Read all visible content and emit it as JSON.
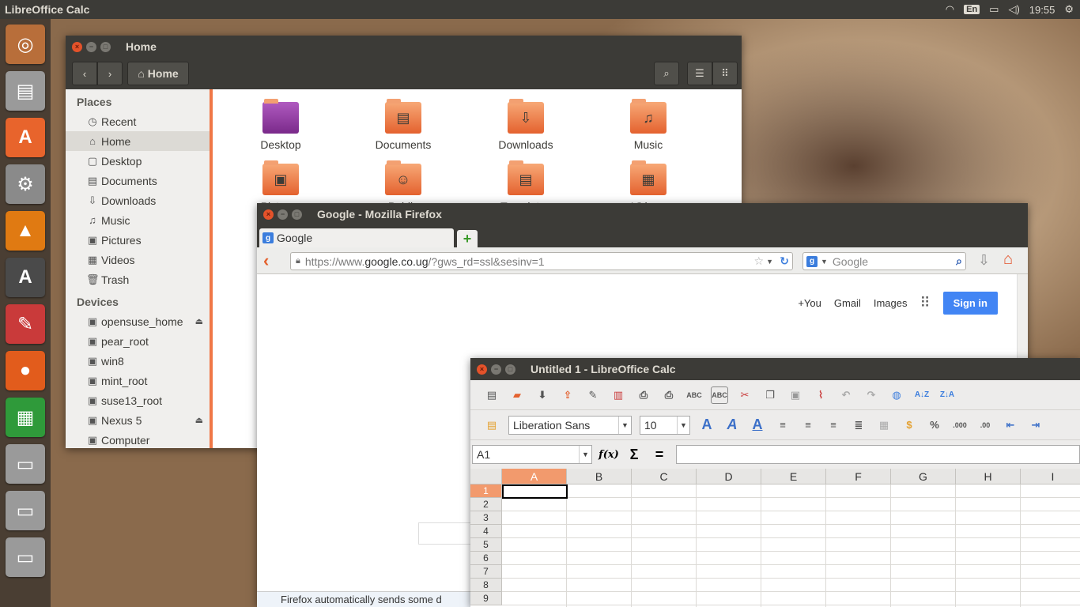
{
  "topbar": {
    "app_title": "LibreOffice Calc",
    "lang": "En",
    "time": "19:55"
  },
  "launcher": [
    {
      "name": "ubuntu-icon",
      "glyph": "◎",
      "color": "#b86e3a"
    },
    {
      "name": "files-icon",
      "glyph": "▤",
      "color": "#9a9a9a"
    },
    {
      "name": "software-center-icon",
      "glyph": "A",
      "color": "#e8642c"
    },
    {
      "name": "system-settings-icon",
      "glyph": "⚙",
      "color": "#8a8a8a"
    },
    {
      "name": "vlc-icon",
      "glyph": "▲",
      "color": "#e07a12"
    },
    {
      "name": "update-manager-icon",
      "glyph": "A",
      "color": "#4a4a4a"
    },
    {
      "name": "document-viewer-icon",
      "glyph": "✎",
      "color": "#c93a3a"
    },
    {
      "name": "firefox-icon",
      "glyph": "●",
      "color": "#e25c1c"
    },
    {
      "name": "libreoffice-calc-icon",
      "glyph": "▦",
      "color": "#2f9a3a"
    },
    {
      "name": "drive-icon",
      "glyph": "▭",
      "color": "#9a9a9a"
    },
    {
      "name": "drive-icon",
      "glyph": "▭",
      "color": "#9a9a9a"
    },
    {
      "name": "drive-icon",
      "glyph": "▭",
      "color": "#9a9a9a"
    }
  ],
  "nautilus": {
    "title": "Home",
    "location": "Home",
    "places_header": "Places",
    "places": [
      "Recent",
      "Home",
      "Desktop",
      "Documents",
      "Downloads",
      "Music",
      "Pictures",
      "Videos",
      "Trash"
    ],
    "devices_header": "Devices",
    "devices": [
      "opensuse_home",
      "pear_root",
      "win8",
      "mint_root",
      "suse13_root",
      "Nexus 5",
      "Computer"
    ],
    "folders": [
      "Desktop",
      "Documents",
      "Downloads",
      "Music",
      "Pictures",
      "Public",
      "Templates",
      "Videos"
    ]
  },
  "firefox": {
    "title": "Google - Mozilla Firefox",
    "tab_label": "Google",
    "url_prefix": "https://www.",
    "url_domain": "google.co.ug",
    "url_rest": "/?gws_rd=ssl&sesinv=1",
    "search_placeholder": "Google",
    "links": [
      "+You",
      "Gmail",
      "Images"
    ],
    "signin": "Sign in",
    "notification": "Firefox automatically sends some d"
  },
  "calc": {
    "title": "Untitled 1 - LibreOffice Calc",
    "font_name": "Liberation Sans",
    "font_size": "10",
    "cell_ref": "A1",
    "columns": [
      "A",
      "B",
      "C",
      "D",
      "E",
      "F",
      "G",
      "H",
      "I"
    ],
    "rows": [
      "1",
      "2",
      "3",
      "4",
      "5",
      "6",
      "7",
      "8",
      "9"
    ]
  }
}
